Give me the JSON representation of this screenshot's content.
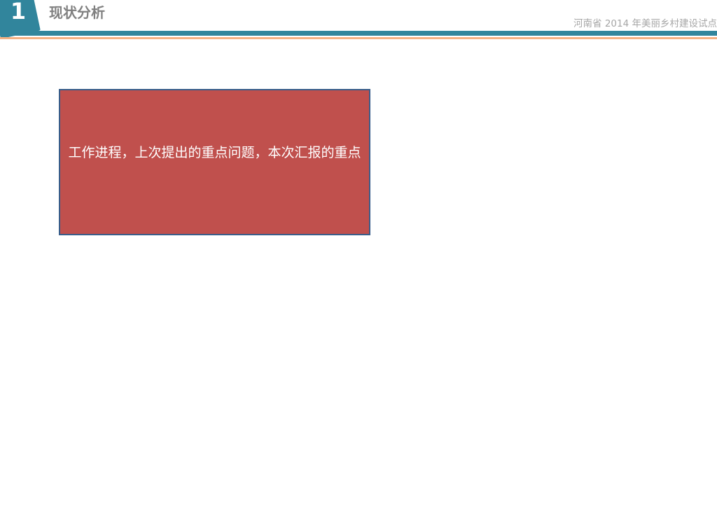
{
  "header": {
    "section_number": "1",
    "section_title": "现状分析",
    "project_title": "河南省 2014 年美丽乡村建设试点",
    "colors": {
      "accent": "#31859c",
      "accent_line": "#f4b183",
      "title_text": "#808080",
      "project_text": "#a6a6a6"
    }
  },
  "main": {
    "note_box": {
      "text": "工作进程，上次提出的重点问题，本次汇报的重点",
      "fill_color": "#c0504d",
      "border_color": "#385d8a",
      "text_color": "#ffffff"
    }
  }
}
